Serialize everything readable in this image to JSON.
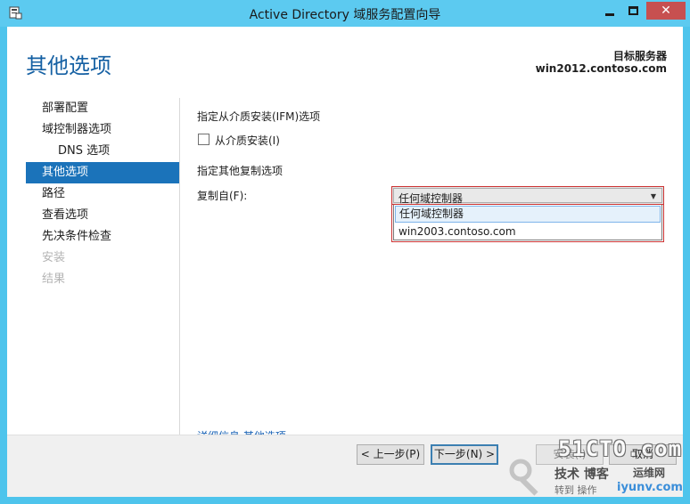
{
  "window": {
    "title": "Active Directory 域服务配置向导"
  },
  "header": {
    "page_title": "其他选项",
    "target_label": "目标服务器",
    "target_server": "win2012.contoso.com"
  },
  "nav": {
    "items": [
      {
        "label": "部署配置",
        "state": "normal"
      },
      {
        "label": "域控制器选项",
        "state": "normal"
      },
      {
        "label": "DNS 选项",
        "state": "normal"
      },
      {
        "label": "其他选项",
        "state": "selected"
      },
      {
        "label": "路径",
        "state": "normal"
      },
      {
        "label": "查看选项",
        "state": "normal"
      },
      {
        "label": "先决条件检查",
        "state": "normal"
      },
      {
        "label": "安装",
        "state": "disabled"
      },
      {
        "label": "结果",
        "state": "disabled"
      }
    ]
  },
  "content": {
    "ifm_section": "指定从介质安装(IFM)选项",
    "ifm_checkbox": "从介质安装(I)",
    "ifm_checked": false,
    "replication_section": "指定其他复制选项",
    "replicate_from_label": "复制自(F):",
    "replicate_from_value": "任何域控制器",
    "dropdown_options": [
      "任何域控制器",
      "win2003.contoso.com"
    ],
    "more_info": "详细信息",
    "more_info_link": "其他选项"
  },
  "footer": {
    "prev": "< 上一步(P)",
    "next": "下一步(N) >",
    "install": "安装(I)",
    "cancel": "取消"
  },
  "watermark": {
    "big": "51CTO.com",
    "mid": "技术 博客",
    "small": "转到 操作",
    "site": "iyunv.com",
    "extra": "运维网"
  },
  "colors": {
    "accent": "#1b73ba",
    "title": "#1560a3",
    "titlebar": "#5ccaf0",
    "close": "#c75050",
    "highlight_border": "#cc3333"
  }
}
